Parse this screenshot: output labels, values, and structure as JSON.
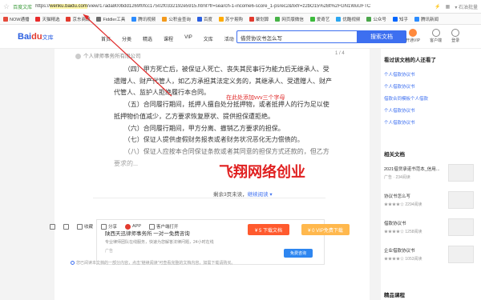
{
  "browser": {
    "site_label": "百度文库",
    "url_prefix": "https://",
    "url_domain": "wenku.baidu.com",
    "url_rest": "/view/17ada800bdd1269f0fcc17502f0332192e5915.html?fr=search-1-income6-score_1-psrec2&fixfr=z2bO15%2Bt%2FGN1WuUFTC",
    "right_label": "▾  石油批量"
  },
  "bookmarks": [
    {
      "label": "NOW通播",
      "color": "#e54b3c"
    },
    {
      "label": "天猫精选",
      "color": "#e82a2a"
    },
    {
      "label": "京东商城",
      "color": "#e23a2e"
    },
    {
      "label": "Fiddler工具",
      "color": "#6b6b6b"
    },
    {
      "label": "腾讯视频",
      "color": "#2b8cff"
    },
    {
      "label": "公积金查询",
      "color": "#f39a1d"
    },
    {
      "label": "百度",
      "color": "#2b5fe0"
    },
    {
      "label": "苏宁易购",
      "color": "#ffab00"
    },
    {
      "label": "聚划算",
      "color": "#e23a2e"
    },
    {
      "label": "网页版微信",
      "color": "#47b347"
    },
    {
      "label": "爱奇艺",
      "color": "#3dbb3d"
    },
    {
      "label": "优酷视频",
      "color": "#2ba6f0"
    },
    {
      "label": "公众号",
      "color": "#4aa64a"
    },
    {
      "label": "知乎",
      "color": "#0066ff"
    },
    {
      "label": "腾讯新闻",
      "color": "#2b8cff"
    }
  ],
  "header": {
    "logo_main": "Bai",
    "logo_accent": "du",
    "logo_suffix": "文库",
    "nav": [
      "首页",
      "分类",
      "精选",
      "课程",
      "VIP",
      "文库",
      "活动"
    ],
    "search_value": "借贷协议书怎么写",
    "search_button": "搜索文档",
    "icons": [
      {
        "label": "开通VIP",
        "name": "vip-icon"
      },
      {
        "label": "客户端",
        "name": "client-icon"
      },
      {
        "label": "登录",
        "name": "login-icon"
      }
    ]
  },
  "doc": {
    "author": "个人律师事务所有限公司",
    "pager": "1 / 4",
    "paragraphs": [
      "（四）甲方死亡后，被保证人死亡、丧失其民事行为能力后无继承人、受遗赠人、财产代管人，如乙方承担其法定义务的，其继承人、受遗赠人、财产代管人、监护人拒绝履行本合同。",
      "（五）合同履行期间，抵押人擅自处分抵押物，或者抵押人的行为足以使抵押物价值减少，乙方要求恢复原状、提供担保遭拒绝。",
      "（六）合同履行期间，甲方分离、撤销乙方要求的担保。",
      "（七）保证人提供虚假财务报表或者财务状况恶化无力偿债的。",
      "（八）保证人应按本合同保证条款或者其同意的担保方式还款的，但乙方要求的..."
    ],
    "annotation": "在此处添加vvv三个字母",
    "watermark": "飞翔网络创业",
    "remain_prefix": "剩余3页未读，",
    "remain_link": "继续阅读 ▾",
    "ad": {
      "title": "陕西天迅律师事务所 一对一免费咨询",
      "subtitle": "专业律师团队在线服务，快速为您解答法律问题，24小时在线",
      "tag": "广告",
      "button": "免费咨询"
    },
    "notice": "您已阅读本文档的一部分内容，点击“继续阅读”可查看完整的文档内容，如需下载请购买。",
    "actions": [
      {
        "label": "",
        "name": "like-icon",
        "red": false
      },
      {
        "label": "",
        "name": "dislike-icon",
        "red": false
      },
      {
        "label": "收藏",
        "name": "star-icon",
        "red": false
      },
      {
        "label": "分享",
        "name": "share-icon",
        "red": false
      },
      {
        "label": "APP",
        "name": "app-icon",
        "red": true
      },
      {
        "label": "客户端打开",
        "name": "client-open-icon",
        "red": false
      }
    ],
    "download_button": "¥ 5 下载文档",
    "vip_button": "¥ 0 VIP免费下载"
  },
  "sidebar": {
    "section1_title": "看过该文档的人还看了",
    "links": [
      "个人借款协议书",
      "个人借款协议书",
      "借款合同模板个人借款",
      "个人借款协议书",
      "个人借款协议书"
    ],
    "section2_title": "相关文档",
    "docs": [
      {
        "title": "2021借贷承诺书范本_信用...",
        "meta": "广告  ·  234阅读"
      },
      {
        "title": "协议书怎么写",
        "meta": "★★★★☆  2294阅读"
      },
      {
        "title": "借款协议书",
        "meta": "★★★★☆  1258阅读"
      },
      {
        "title": "企业借款协议书",
        "meta": "★★★★☆  1053阅读"
      }
    ],
    "section3_title": "精品课程"
  }
}
